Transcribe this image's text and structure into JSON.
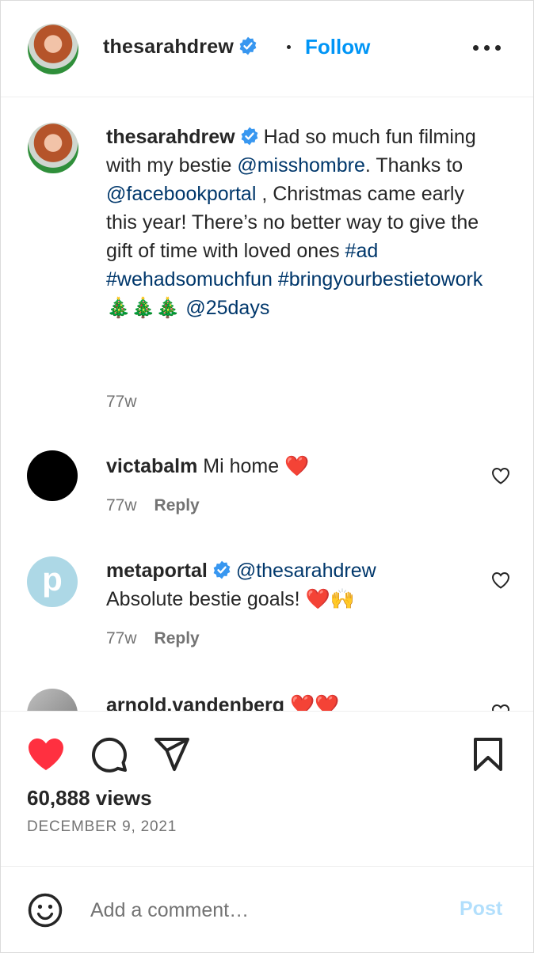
{
  "header": {
    "username": "thesarahdrew",
    "follow_label": "Follow",
    "more_icon": "more-icon",
    "verified_icon": "verified-badge-icon",
    "separator": "•"
  },
  "caption": {
    "username": "thesarahdrew",
    "text_1": "Had so much fun filming with my bestie ",
    "mention_1": "@misshombre",
    "text_2": ". Thanks to ",
    "mention_2": "@facebookportal",
    "text_3": " , Christmas came early this year! There’s no better way to give the gift of time with loved ones ",
    "hashtag_1": "#ad",
    "hashtag_2": "#wehadsomuchfun",
    "hashtag_3": "#bringyourbestietowork",
    "emoji": "🎄🎄🎄",
    "mention_3": "@25days",
    "time": "77w"
  },
  "comments": [
    {
      "username": "victabalm",
      "text": "Mi home ❤️",
      "time": "77w",
      "reply_label": "Reply"
    },
    {
      "username": "metaportal",
      "mention": "@thesarahdrew",
      "text": "Absolute bestie goals! ❤️🙌",
      "time": "77w",
      "reply_label": "Reply",
      "avatar_letter": "p"
    },
    {
      "username": "arnold.vandenberg",
      "text": "❤️❤️"
    }
  ],
  "actions": {
    "like_icon": "heart-filled-icon",
    "comment_icon": "comment-icon",
    "share_icon": "paper-plane-icon",
    "save_icon": "bookmark-icon",
    "like_color": "#ff3040",
    "views": "60,888 views",
    "date": "DECEMBER 9, 2021"
  },
  "comment_box": {
    "placeholder": "Add a comment…",
    "post_label": "Post",
    "emoji_icon": "smiley-icon"
  },
  "colors": {
    "link": "#00376b",
    "follow": "#0095f6",
    "verified": "#3897f0",
    "post_disabled": "#b2dffc",
    "secondary_text": "#737373"
  }
}
